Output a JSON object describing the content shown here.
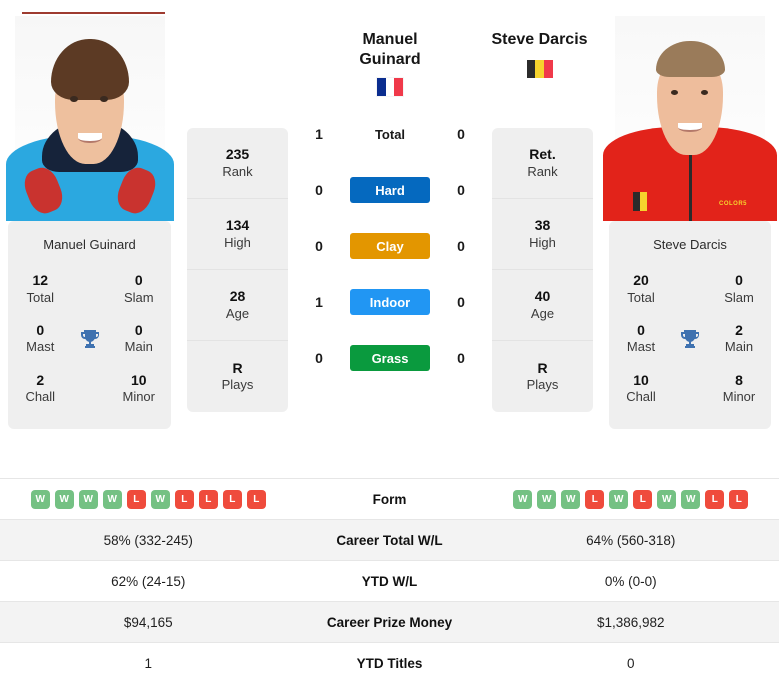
{
  "accent_color": "#9e3b30",
  "players": {
    "left": {
      "name": "Manuel Guinard",
      "name_line1": "Manuel",
      "name_line2": "Guinard",
      "flag_name": "flag-france",
      "flag_colors": [
        "#0b2d8f",
        "#ffffff",
        "#f0394a"
      ],
      "card_title": "Manuel Guinard",
      "titles": {
        "total_value": "12",
        "total_label": "Total",
        "slam_value": "0",
        "slam_label": "Slam",
        "mast_value": "0",
        "mast_label": "Mast",
        "main_value": "0",
        "main_label": "Main",
        "chall_value": "2",
        "chall_label": "Chall",
        "minor_value": "10",
        "minor_label": "Minor"
      },
      "info": [
        {
          "value": "235",
          "label": "Rank"
        },
        {
          "value": "134",
          "label": "High"
        },
        {
          "value": "28",
          "label": "Age"
        },
        {
          "value": "R",
          "label": "Plays"
        }
      ],
      "form": [
        "W",
        "W",
        "W",
        "W",
        "L",
        "W",
        "L",
        "L",
        "L",
        "L"
      ],
      "career_total_wl": "58% (332-245)",
      "ytd_wl": "62% (24-15)",
      "career_prize_money": "$94,165",
      "ytd_titles": "1"
    },
    "right": {
      "name": "Steve Darcis",
      "name_line1": "Steve Darcis",
      "name_line2": "",
      "flag_name": "flag-belgium",
      "flag_colors": [
        "#2b2b2b",
        "#f6d32d",
        "#f0394a"
      ],
      "card_title": "Steve Darcis",
      "titles": {
        "total_value": "20",
        "total_label": "Total",
        "slam_value": "0",
        "slam_label": "Slam",
        "mast_value": "0",
        "mast_label": "Mast",
        "main_value": "2",
        "main_label": "Main",
        "chall_value": "10",
        "chall_label": "Chall",
        "minor_value": "8",
        "minor_label": "Minor"
      },
      "info": [
        {
          "value": "Ret.",
          "label": "Rank"
        },
        {
          "value": "38",
          "label": "High"
        },
        {
          "value": "40",
          "label": "Age"
        },
        {
          "value": "R",
          "label": "Plays"
        }
      ],
      "form": [
        "W",
        "W",
        "W",
        "L",
        "W",
        "L",
        "W",
        "W",
        "L",
        "L"
      ],
      "career_total_wl": "64% (560-318)",
      "ytd_wl": "0% (0-0)",
      "career_prize_money": "$1,386,982",
      "ytd_titles": "0"
    }
  },
  "head_to_head": [
    {
      "surface": "Total",
      "left": "1",
      "right": "0",
      "color": "transparent",
      "plain": true
    },
    {
      "surface": "Hard",
      "left": "0",
      "right": "0",
      "color": "#0569bf",
      "plain": false
    },
    {
      "surface": "Clay",
      "left": "0",
      "right": "0",
      "color": "#e39600",
      "plain": false
    },
    {
      "surface": "Indoor",
      "left": "1",
      "right": "0",
      "color": "#2196f3",
      "plain": false
    },
    {
      "surface": "Grass",
      "left": "0",
      "right": "0",
      "color": "#0a9a3e",
      "plain": false
    }
  ],
  "table": {
    "form_label": "Form",
    "rows": [
      {
        "label": "Career Total W/L",
        "left": "58% (332-245)",
        "right": "64% (560-318)"
      },
      {
        "label": "YTD W/L",
        "left": "62% (24-15)",
        "right": "0% (0-0)"
      },
      {
        "label": "Career Prize Money",
        "left": "$94,165",
        "right": "$1,386,982"
      },
      {
        "label": "YTD Titles",
        "left": "1",
        "right": "0"
      }
    ]
  },
  "icons": {
    "trophy": "trophy-icon"
  }
}
